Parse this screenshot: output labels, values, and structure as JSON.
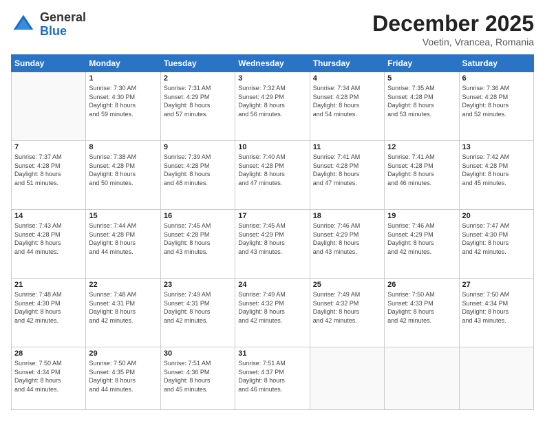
{
  "logo": {
    "general": "General",
    "blue": "Blue"
  },
  "title": "December 2025",
  "subtitle": "Voetin, Vrancea, Romania",
  "weekdays": [
    "Sunday",
    "Monday",
    "Tuesday",
    "Wednesday",
    "Thursday",
    "Friday",
    "Saturday"
  ],
  "weeks": [
    [
      {
        "day": "",
        "info": ""
      },
      {
        "day": "1",
        "info": "Sunrise: 7:30 AM\nSunset: 4:30 PM\nDaylight: 8 hours\nand 59 minutes."
      },
      {
        "day": "2",
        "info": "Sunrise: 7:31 AM\nSunset: 4:29 PM\nDaylight: 8 hours\nand 57 minutes."
      },
      {
        "day": "3",
        "info": "Sunrise: 7:32 AM\nSunset: 4:29 PM\nDaylight: 8 hours\nand 56 minutes."
      },
      {
        "day": "4",
        "info": "Sunrise: 7:34 AM\nSunset: 4:28 PM\nDaylight: 8 hours\nand 54 minutes."
      },
      {
        "day": "5",
        "info": "Sunrise: 7:35 AM\nSunset: 4:28 PM\nDaylight: 8 hours\nand 53 minutes."
      },
      {
        "day": "6",
        "info": "Sunrise: 7:36 AM\nSunset: 4:28 PM\nDaylight: 8 hours\nand 52 minutes."
      }
    ],
    [
      {
        "day": "7",
        "info": "Sunrise: 7:37 AM\nSunset: 4:28 PM\nDaylight: 8 hours\nand 51 minutes."
      },
      {
        "day": "8",
        "info": "Sunrise: 7:38 AM\nSunset: 4:28 PM\nDaylight: 8 hours\nand 50 minutes."
      },
      {
        "day": "9",
        "info": "Sunrise: 7:39 AM\nSunset: 4:28 PM\nDaylight: 8 hours\nand 48 minutes."
      },
      {
        "day": "10",
        "info": "Sunrise: 7:40 AM\nSunset: 4:28 PM\nDaylight: 8 hours\nand 47 minutes."
      },
      {
        "day": "11",
        "info": "Sunrise: 7:41 AM\nSunset: 4:28 PM\nDaylight: 8 hours\nand 47 minutes."
      },
      {
        "day": "12",
        "info": "Sunrise: 7:41 AM\nSunset: 4:28 PM\nDaylight: 8 hours\nand 46 minutes."
      },
      {
        "day": "13",
        "info": "Sunrise: 7:42 AM\nSunset: 4:28 PM\nDaylight: 8 hours\nand 45 minutes."
      }
    ],
    [
      {
        "day": "14",
        "info": "Sunrise: 7:43 AM\nSunset: 4:28 PM\nDaylight: 8 hours\nand 44 minutes."
      },
      {
        "day": "15",
        "info": "Sunrise: 7:44 AM\nSunset: 4:28 PM\nDaylight: 8 hours\nand 44 minutes."
      },
      {
        "day": "16",
        "info": "Sunrise: 7:45 AM\nSunset: 4:28 PM\nDaylight: 8 hours\nand 43 minutes."
      },
      {
        "day": "17",
        "info": "Sunrise: 7:45 AM\nSunset: 4:29 PM\nDaylight: 8 hours\nand 43 minutes."
      },
      {
        "day": "18",
        "info": "Sunrise: 7:46 AM\nSunset: 4:29 PM\nDaylight: 8 hours\nand 43 minutes."
      },
      {
        "day": "19",
        "info": "Sunrise: 7:46 AM\nSunset: 4:29 PM\nDaylight: 8 hours\nand 42 minutes."
      },
      {
        "day": "20",
        "info": "Sunrise: 7:47 AM\nSunset: 4:30 PM\nDaylight: 8 hours\nand 42 minutes."
      }
    ],
    [
      {
        "day": "21",
        "info": "Sunrise: 7:48 AM\nSunset: 4:30 PM\nDaylight: 8 hours\nand 42 minutes."
      },
      {
        "day": "22",
        "info": "Sunrise: 7:48 AM\nSunset: 4:31 PM\nDaylight: 8 hours\nand 42 minutes."
      },
      {
        "day": "23",
        "info": "Sunrise: 7:49 AM\nSunset: 4:31 PM\nDaylight: 8 hours\nand 42 minutes."
      },
      {
        "day": "24",
        "info": "Sunrise: 7:49 AM\nSunset: 4:32 PM\nDaylight: 8 hours\nand 42 minutes."
      },
      {
        "day": "25",
        "info": "Sunrise: 7:49 AM\nSunset: 4:32 PM\nDaylight: 8 hours\nand 42 minutes."
      },
      {
        "day": "26",
        "info": "Sunrise: 7:50 AM\nSunset: 4:33 PM\nDaylight: 8 hours\nand 42 minutes."
      },
      {
        "day": "27",
        "info": "Sunrise: 7:50 AM\nSunset: 4:34 PM\nDaylight: 8 hours\nand 43 minutes."
      }
    ],
    [
      {
        "day": "28",
        "info": "Sunrise: 7:50 AM\nSunset: 4:34 PM\nDaylight: 8 hours\nand 44 minutes."
      },
      {
        "day": "29",
        "info": "Sunrise: 7:50 AM\nSunset: 4:35 PM\nDaylight: 8 hours\nand 44 minutes."
      },
      {
        "day": "30",
        "info": "Sunrise: 7:51 AM\nSunset: 4:36 PM\nDaylight: 8 hours\nand 45 minutes."
      },
      {
        "day": "31",
        "info": "Sunrise: 7:51 AM\nSunset: 4:37 PM\nDaylight: 8 hours\nand 46 minutes."
      },
      {
        "day": "",
        "info": ""
      },
      {
        "day": "",
        "info": ""
      },
      {
        "day": "",
        "info": ""
      }
    ]
  ]
}
